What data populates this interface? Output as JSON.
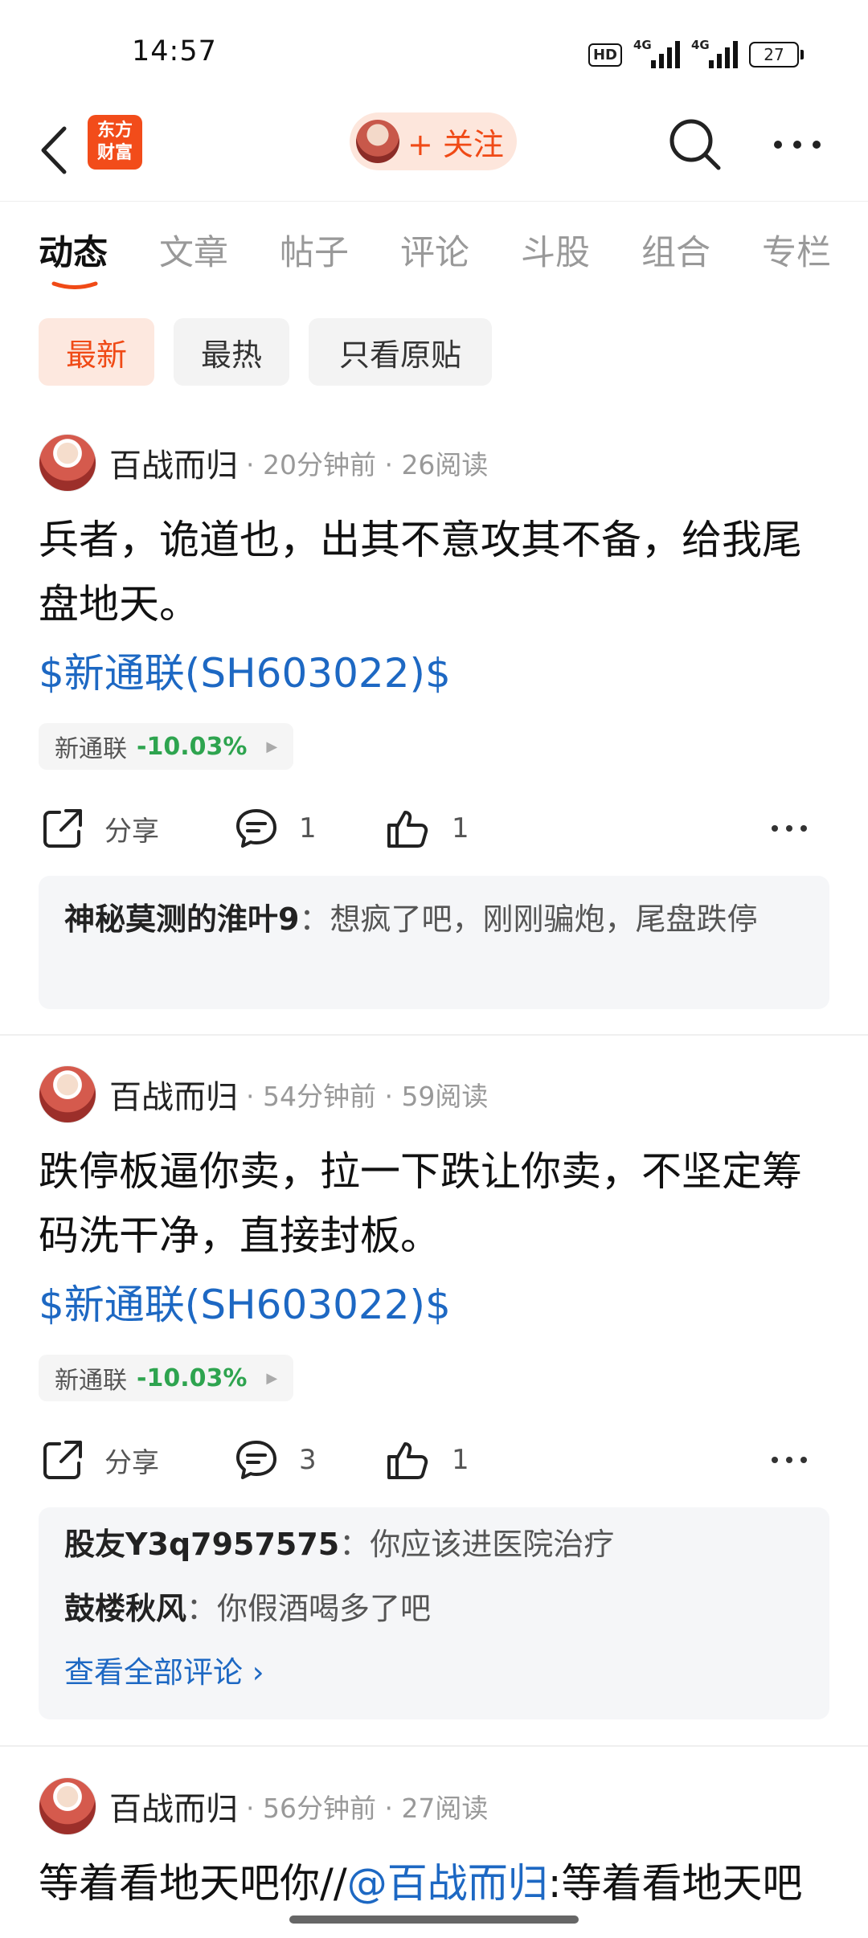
{
  "status_bar": {
    "time": "14:57",
    "hd": "HD",
    "net1": "4G",
    "net2": "4G",
    "battery": "27"
  },
  "nav": {
    "logo_line1": "东方",
    "logo_line2": "财富",
    "follow_label": "+ 关注"
  },
  "tabs": [
    "动态",
    "文章",
    "帖子",
    "评论",
    "斗股",
    "组合",
    "专栏"
  ],
  "active_tab": "动态",
  "filters": [
    "最新",
    "最热",
    "只看原贴"
  ],
  "accent_color": "#f04a16",
  "link_color": "#1d68c3",
  "positive_color": "#2ea44f",
  "posts": [
    {
      "author": "百战而归",
      "meta": "· 20分钟前 · 26阅读",
      "text": "兵者，诡道也，出其不意攻其不备，给我尾盘地天。",
      "stock_tag": "$新通联(SH603022)$",
      "stock_name": "新通联",
      "stock_change": "-10.03%",
      "share_label": "分享",
      "comment_count": "1",
      "like_count": "1",
      "comments": [
        {
          "user": "神秘莫测的淮叶9",
          "sep": "：",
          "text": "想疯了吧，刚刚骗炮，尾盘跌停"
        }
      ]
    },
    {
      "author": "百战而归",
      "meta": "· 54分钟前 · 59阅读",
      "text": "跌停板逼你卖，拉一下跌让你卖，不坚定筹码洗干净，直接封板。",
      "stock_tag": "$新通联(SH603022)$",
      "stock_name": "新通联",
      "stock_change": "-10.03%",
      "share_label": "分享",
      "comment_count": "3",
      "like_count": "1",
      "comments": [
        {
          "user": "股友Y3q7957575",
          "sep": "：",
          "text": "你应该进医院治疗"
        },
        {
          "user": "鼓楼秋风",
          "sep": "：",
          "text": "你假酒喝多了吧"
        }
      ],
      "view_all": "查看全部评论 ›"
    },
    {
      "author": "百战而归",
      "meta": "· 56分钟前 · 27阅读",
      "text_prefix": "等着看地天吧你//",
      "mention": "@百战而归",
      "text_suffix": ":等着看地天吧"
    }
  ]
}
